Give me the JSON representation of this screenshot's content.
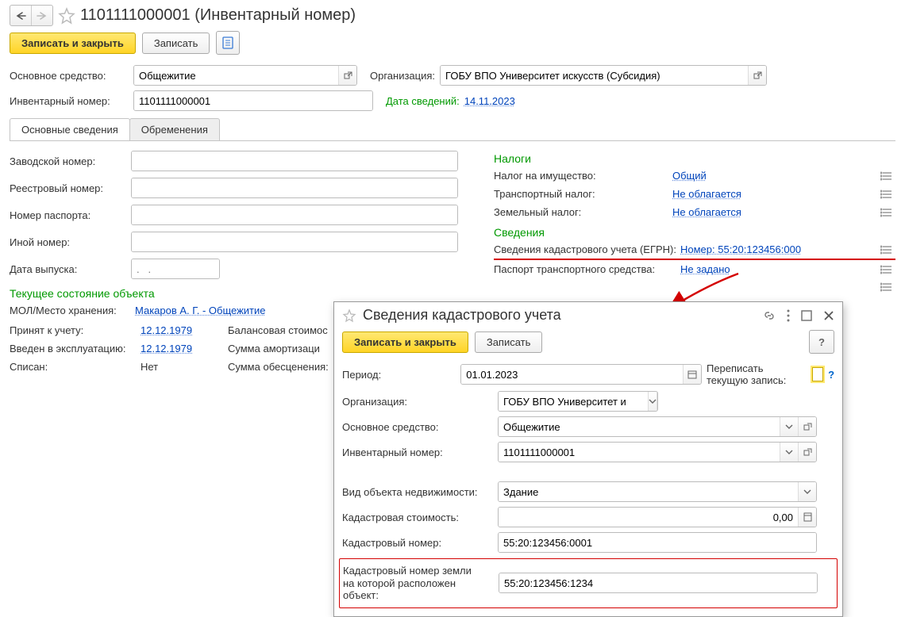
{
  "header": {
    "title": "1101111000001 (Инвентарный номер)"
  },
  "toolbar": {
    "save_close": "Записать и закрыть",
    "save": "Записать"
  },
  "top_fields": {
    "main_asset_label": "Основное средство:",
    "main_asset_value": "Общежитие",
    "org_label": "Организация:",
    "org_value": "ГОБУ ВПО Университет искусств (Субсидия)",
    "inv_num_label": "Инвентарный номер:",
    "inv_num_value": "1101111000001",
    "info_date_label": "Дата сведений:",
    "info_date_value": "14.11.2023"
  },
  "tabs": {
    "main": "Основные сведения",
    "encumb": "Обременения"
  },
  "left": {
    "factory_num": "Заводской номер:",
    "registry_num": "Реестровый номер:",
    "passport_num": "Номер паспорта:",
    "other_num": "Иной номер:",
    "issue_date": "Дата выпуска:",
    "issue_date_ph": ".   .",
    "state_head": "Текущее состояние объекта",
    "mol_label": "МОЛ/Место хранения:",
    "mol_value": "Макаров А. Г. - Общежитие",
    "accepted_label": "Принят к учету:",
    "accepted_value": "12.12.1979",
    "inuse_label": "Введен в эксплуатацию:",
    "inuse_value": "12.12.1979",
    "written_off_label": "Списан:",
    "written_off_value": "Нет",
    "balance_cost_label": "Балансовая стоимос",
    "amort_label": "Сумма амортизаци",
    "impair_label": "Сумма обесценения:"
  },
  "right": {
    "taxes_head": "Налоги",
    "property_tax_label": "Налог на имущество:",
    "property_tax_value": "Общий",
    "transport_tax_label": "Транспортный налог:",
    "transport_tax_value": "Не облагается",
    "land_tax_label": "Земельный налог:",
    "land_tax_value": "Не облагается",
    "info_head": "Сведения",
    "cadastre_label": "Сведения кадастрового учета (ЕГРН):",
    "cadastre_value": "Номер: 55:20:123456:000",
    "vehicle_passport_label": "Паспорт транспортного средства:",
    "vehicle_passport_value": "Не задано"
  },
  "modal": {
    "title": "Сведения кадастрового учета",
    "save_close": "Записать и закрыть",
    "save": "Записать",
    "help": "?",
    "period_label": "Период:",
    "period_value": "01.01.2023",
    "overwrite_label": "Переписать текущую запись:",
    "org_label": "Организация:",
    "org_value": "ГОБУ ВПО Университет и",
    "asset_label": "Основное средство:",
    "asset_value": "Общежитие",
    "inv_label": "Инвентарный номер:",
    "inv_value": "1101111000001",
    "obj_type_label": "Вид объекта недвижимости:",
    "obj_type_value": "Здание",
    "cadastre_cost_label": "Кадастровая стоимость:",
    "cadastre_cost_value": "0,00",
    "cadastre_num_label": "Кадастровый номер:",
    "cadastre_num_value": "55:20:123456:0001",
    "land_num_label_1": "Кадастровый номер земли",
    "land_num_label_2": "на которой расположен объект:",
    "land_num_value": "55:20:123456:1234"
  }
}
